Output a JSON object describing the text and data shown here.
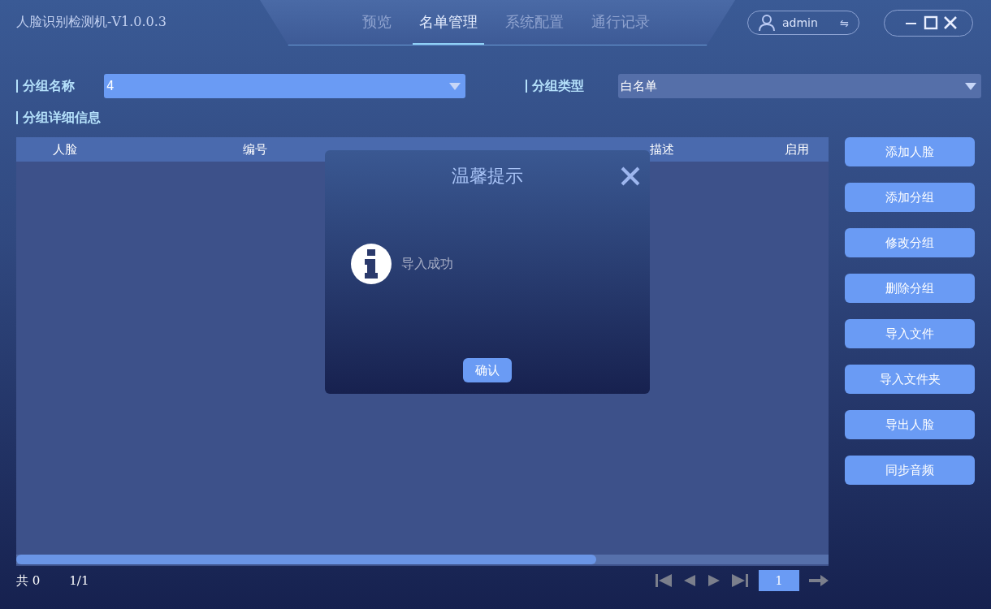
{
  "window": {
    "title": "人脸识别检测机-V1.0.0.3"
  },
  "tabs": [
    {
      "label": "预览",
      "selected": false
    },
    {
      "label": "名单管理",
      "selected": true
    },
    {
      "label": "系统配置",
      "selected": false
    },
    {
      "label": "通行记录",
      "selected": false
    }
  ],
  "user": {
    "name": "admin",
    "switch_symbol": "⇋"
  },
  "filters": [
    {
      "label": "分组名称",
      "value": "4",
      "kind": "accent"
    },
    {
      "label": "分组类型",
      "value": "白名单",
      "kind": "muted"
    }
  ],
  "section_title": "分组详细信息",
  "table": {
    "columns": [
      "人脸",
      "编号",
      "描述",
      "启用"
    ]
  },
  "actions": [
    "添加人脸",
    "添加分组",
    "修改分组",
    "删除分组",
    "导入文件",
    "导入文件夹",
    "导出人脸",
    "同步音频"
  ],
  "footer": {
    "total": "共 0",
    "pages": "1/1",
    "page_input": "1"
  },
  "dialog": {
    "title": "温馨提示",
    "message": "导入成功",
    "confirm": "确认"
  }
}
